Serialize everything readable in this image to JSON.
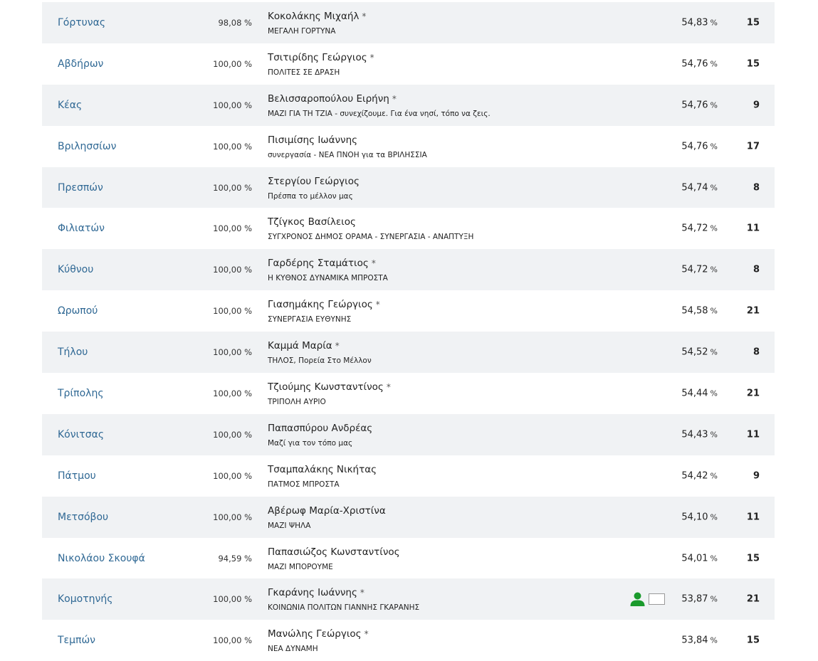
{
  "rows": [
    {
      "municipality": "Γόρτυνας",
      "counted": "98,08 %",
      "candidate": "Κοκολάκης Μιχαήλ",
      "star": "*",
      "party": "ΜΕΓΑΛΗ ΓΟΡΤΥΝΑ",
      "percent": "54,83",
      "unit": "%",
      "seats": "15"
    },
    {
      "municipality": "Αβδήρων",
      "counted": "100,00 %",
      "candidate": "Τσιτιρίδης Γεώργιος",
      "star": "*",
      "party": "ΠΟΛΙΤΕΣ ΣΕ ΔΡΑΣΗ",
      "percent": "54,76",
      "unit": "%",
      "seats": "15"
    },
    {
      "municipality": "Κέας",
      "counted": "100,00 %",
      "candidate": "Βελισσαροπούλου Ειρήνη",
      "star": "*",
      "party": "ΜΑΖΙ ΓΙΑ ΤΗ ΤΖΙΑ - συνεχίζουμε. Για ένα νησί, τόπο να ζεις.",
      "percent": "54,76",
      "unit": "%",
      "seats": "9"
    },
    {
      "municipality": "Βριλησσίων",
      "counted": "100,00 %",
      "candidate": "Πισιμίσης Ιωάννης",
      "star": "",
      "party": "συνεργασία - ΝΕΑ ΠΝΟΗ για τα ΒΡΙΛΗΣΣΙΑ",
      "percent": "54,76",
      "unit": "%",
      "seats": "17"
    },
    {
      "municipality": "Πρεσπών",
      "counted": "100,00 %",
      "candidate": "Στεργίου Γεώργιος",
      "star": "",
      "party": "Πρέσπα το μέλλον μας",
      "percent": "54,74",
      "unit": "%",
      "seats": "8"
    },
    {
      "municipality": "Φιλιατών",
      "counted": "100,00 %",
      "candidate": "Τζίγκος Βασίλειος",
      "star": "",
      "party": "ΣΥΓΧΡΟΝΟΣ ΔΗΜΟΣ ΟΡΑΜΑ - ΣΥΝΕΡΓΑΣΙΑ - ΑΝΑΠΤΥΞΗ",
      "percent": "54,72",
      "unit": "%",
      "seats": "11"
    },
    {
      "municipality": "Κύθνου",
      "counted": "100,00 %",
      "candidate": "Γαρδέρης Σταμάτιος",
      "star": "*",
      "party": "Η ΚΥΘΝΟΣ ΔΥΝΑΜΙΚΑ ΜΠΡΟΣΤΑ",
      "percent": "54,72",
      "unit": "%",
      "seats": "8"
    },
    {
      "municipality": "Ωρωπού",
      "counted": "100,00 %",
      "candidate": "Γιασημάκης Γεώργιος",
      "star": "*",
      "party": "ΣΥΝΕΡΓΑΣΙΑ ΕΥΘΥΝΗΣ",
      "percent": "54,58",
      "unit": "%",
      "seats": "21"
    },
    {
      "municipality": "Τήλου",
      "counted": "100,00 %",
      "candidate": "Καμμά Μαρία",
      "star": "*",
      "party": "ΤΗΛΟΣ, Πορεία Στο Μέλλον",
      "percent": "54,52",
      "unit": "%",
      "seats": "8"
    },
    {
      "municipality": "Τρίπολης",
      "counted": "100,00 %",
      "candidate": "Τζιούμης Κωνσταντίνος",
      "star": "*",
      "party": "ΤΡΙΠΟΛΗ ΑΥΡΙΟ",
      "percent": "54,44",
      "unit": "%",
      "seats": "21"
    },
    {
      "municipality": "Κόνιτσας",
      "counted": "100,00 %",
      "candidate": "Παπασπύρου Ανδρέας",
      "star": "",
      "party": "Μαζί για τον τόπο μας",
      "percent": "54,43",
      "unit": "%",
      "seats": "11"
    },
    {
      "municipality": "Πάτμου",
      "counted": "100,00 %",
      "candidate": "Τσαμπαλάκης Νικήτας",
      "star": "",
      "party": "ΠΑΤΜΟΣ ΜΠΡΟΣΤΑ",
      "percent": "54,42",
      "unit": "%",
      "seats": "9"
    },
    {
      "municipality": "Μετσόβου",
      "counted": "100,00 %",
      "candidate": "Αβέρωφ Μαρία-Χριστίνα",
      "star": "",
      "party": "ΜΑΖΙ ΨΗΛΑ",
      "percent": "54,10",
      "unit": "%",
      "seats": "11"
    },
    {
      "municipality": "Νικολάου Σκουφά",
      "counted": "94,59 %",
      "candidate": "Παπασιώζος Κωνσταντίνος",
      "star": "",
      "party": "ΜΑΖΙ ΜΠΟΡΟΥΜΕ",
      "percent": "54,01",
      "unit": "%",
      "seats": "15"
    },
    {
      "municipality": "Κομοτηνής",
      "counted": "100,00 %",
      "candidate": "Γκαράνης Ιωάννης",
      "star": "*",
      "party": "ΚΟΙΝΩΝΙΑ ΠΟΛΙΤΩΝ ΓΙΑΝΝΗΣ ΓΚΑΡΑΝΗΣ",
      "percent": "53,87",
      "unit": "%",
      "seats": "21",
      "icons": [
        "user-icon",
        "box-icon"
      ]
    },
    {
      "municipality": "Τεμπών",
      "counted": "100,00 %",
      "candidate": "Μανώλης Γεώργιος",
      "star": "*",
      "party": "ΝΕΑ ΔΥΝΑΜΗ",
      "percent": "53,84",
      "unit": "%",
      "seats": "15"
    }
  ],
  "colors": {
    "row_alt_bg": "#f0f2f4",
    "link": "#2f6894",
    "user_icon": "#1a9a2c"
  }
}
